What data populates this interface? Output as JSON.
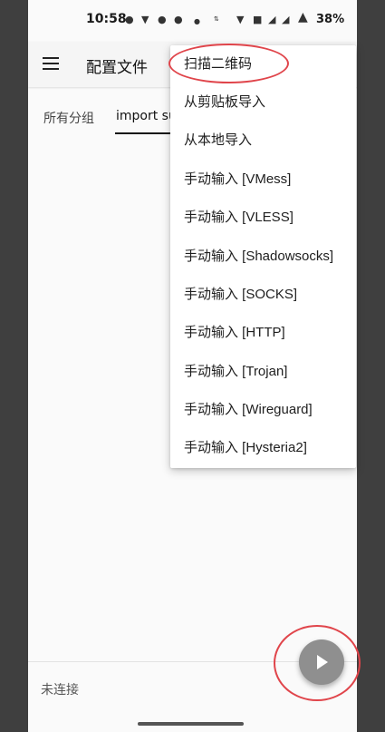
{
  "status_bar": {
    "time": "10:58",
    "battery_text": "38%",
    "icons": [
      "chat-bubble-icon",
      "vpn-key-icon",
      "wechat-icon",
      "wechat-icon",
      "dot-icon",
      "data-speed-icon",
      "wifi-icon",
      "hd-icon",
      "signal-icon",
      "signal-icon",
      "battery-icon"
    ]
  },
  "app_bar": {
    "title": "配置文件"
  },
  "tabs": [
    {
      "label": "所有分组"
    },
    {
      "label": "import su"
    }
  ],
  "menu": {
    "items": [
      {
        "label": "扫描二维码"
      },
      {
        "label": "从剪贴板导入"
      },
      {
        "label": "从本地导入"
      },
      {
        "label": "手动输入 [VMess]"
      },
      {
        "label": "手动输入 [VLESS]"
      },
      {
        "label": "手动输入 [Shadowsocks]"
      },
      {
        "label": "手动输入 [SOCKS]"
      },
      {
        "label": "手动输入 [HTTP]"
      },
      {
        "label": "手动输入 [Trojan]"
      },
      {
        "label": "手动输入 [Wireguard]"
      },
      {
        "label": "手动输入 [Hysteria2]"
      }
    ]
  },
  "footer": {
    "status": "未连接"
  },
  "colors": {
    "annotation": "#e0454b",
    "fab": "#8f8f8f"
  }
}
